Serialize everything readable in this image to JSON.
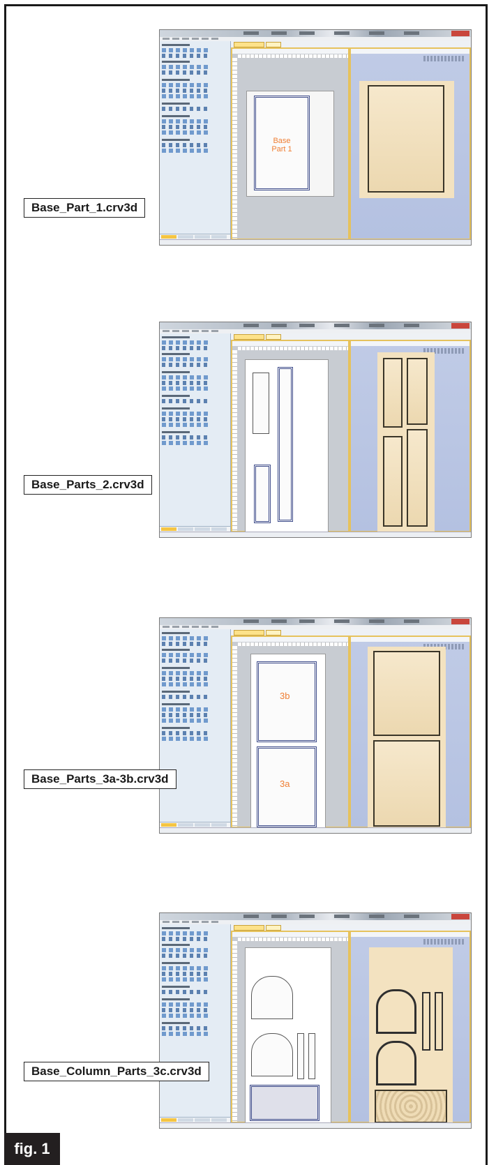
{
  "figure": {
    "tag": "fig. 1"
  },
  "screenshots": [
    {
      "caption": "Base_Part_1.crv3d",
      "part_label_line1": "Base",
      "part_label_line2": "Part 1"
    },
    {
      "caption": "Base_Parts_2.crv3d"
    },
    {
      "caption": "Base_Parts_3a-3b.crv3d",
      "part_label_top": "3b",
      "part_label_bottom": "3a"
    },
    {
      "caption": "Base_Column_Parts_3c.crv3d"
    }
  ]
}
